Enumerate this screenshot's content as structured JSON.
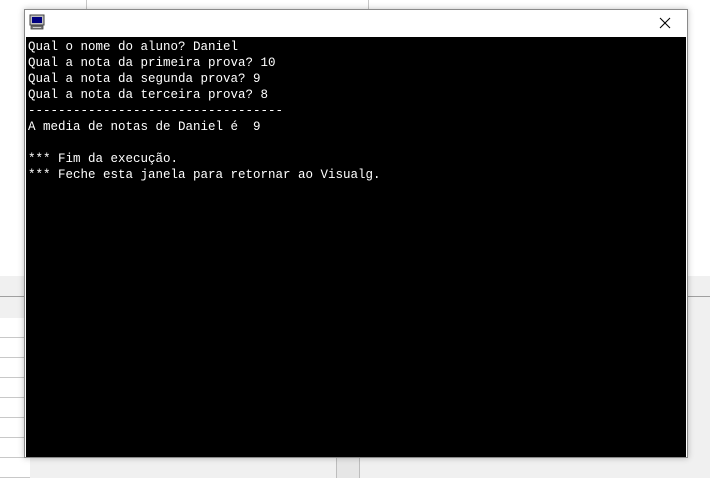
{
  "window": {
    "title": "",
    "icon": "console-app-icon",
    "close_icon": "close-icon"
  },
  "console": {
    "lines": [
      "Qual o nome do aluno? Daniel",
      "Qual a nota da primeira prova? 10",
      "Qual a nota da segunda prova? 9",
      "Qual a nota da terceira prova? 8",
      "----------------------------------",
      "A media de notas de Daniel é  9",
      "",
      "*** Fim da execução.",
      "*** Feche esta janela para retornar ao Visualg."
    ]
  },
  "colors": {
    "console_background": "#000000",
    "console_text": "#ffffff",
    "titlebar": "#ffffff"
  }
}
